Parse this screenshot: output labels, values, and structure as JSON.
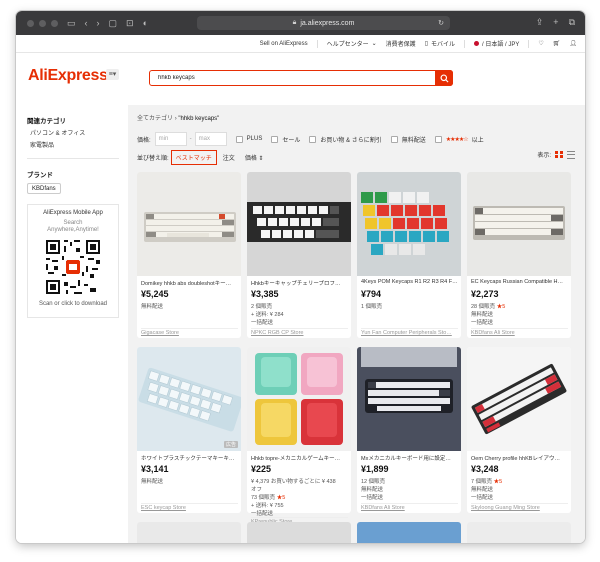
{
  "browser": {
    "url": "ja.aliexpress.com"
  },
  "topstrip": {
    "sell": "Sell on AliExpress",
    "help": "ヘルプセンター",
    "consumer": "消費者保護",
    "mobile": "モバイル",
    "locale": "/ 日本語 / JPY"
  },
  "header": {
    "logo": "AliExpress",
    "search_value": "hhkb keycaps"
  },
  "sidebar": {
    "related_heading": "関連カテゴリ",
    "related": [
      "パソコン & オフィス",
      "家電製品"
    ],
    "brand_heading": "ブランド",
    "brand_chip": "KBDfans",
    "app_title": "AliExpress Mobile App",
    "app_line2": "Search",
    "app_line3": "Anywhere,Anytime!",
    "app_scan": "Scan or click to download"
  },
  "main": {
    "breadcrumb_all": "全てカテゴリ",
    "breadcrumb_sep": "›",
    "breadcrumb_query": "\"hhkb keycaps\"",
    "price_label": "価格:",
    "price_min": "min",
    "price_max": "max",
    "filters": [
      "PLUS",
      "セール",
      "お買い物 & さらに割引",
      "無料配送"
    ],
    "rating_stars": "★★★★☆",
    "rating_suffix": "以上",
    "sort_label": "並び替え順:",
    "sort_best": "ベストマッチ",
    "sort_orders": "注文",
    "sort_price": "価格 ⇕",
    "view_label": "表示:"
  },
  "products": [
    {
      "title": "Domikey hhkb abs doubleshotキー…",
      "price": "¥5,245",
      "l1": "無料配送",
      "l2": "",
      "l3": "",
      "l4": "",
      "store": "Gigacase Store"
    },
    {
      "title": "Hhkbキーキャップチェリープロフ…",
      "price": "¥3,385",
      "l1": "2 個販売",
      "l2": "+ 送料: ¥ 284",
      "l3": "一括配送",
      "l4": "",
      "store": "NPKC RGB CP Store"
    },
    {
      "title": "4Keys POM Keycaps R1 R2 R3 R4 F…",
      "price": "¥794",
      "l1": "1 個販売",
      "l2": "",
      "l3": "",
      "l4": "",
      "store": "Yun Fan Computer Peripherals Sto…"
    },
    {
      "title": "EC Keycaps Russian Compatible H…",
      "price": "¥2,273",
      "l1": "28 個販売",
      "l1_star": "★5",
      "l2": "無料配送",
      "l3": "一括配送",
      "l4": "",
      "store": "KBDfans Ali Store"
    },
    {
      "title": "ホワイトプラスチックテーマキーキ…",
      "price": "¥3,141",
      "l1": "無料配送",
      "l2": "",
      "l3": "",
      "l4": "",
      "store": "ESC keycap Store",
      "badge": "広告"
    },
    {
      "title": "Hhkb topre-メカニカルゲームキー…",
      "price": "¥225",
      "l1": "¥ 4,379 お買い物するごとに ¥ 438",
      "l2": "オフ",
      "l3": "73 個販売",
      "l3_star": "★5",
      "l4": "+ 送料: ¥ 755",
      "l5": "一括配送",
      "store": "KPrepublic Store"
    },
    {
      "title": "Mxメカニカルキーボード用に設定…",
      "price": "¥1,899",
      "l1": "12 個販売",
      "l2": "無料配送",
      "l3": "一括配送",
      "l4": "",
      "store": "KBDfans Ali Store"
    },
    {
      "title": "Oem Cherry profile hhKBレイアウ…",
      "price": "¥3,248",
      "l1": "7 個販売",
      "l1_star": "★5",
      "l2": "無料配送",
      "l3": "一括配送",
      "l4": "",
      "store": "Skyloong Guang Ming Store"
    }
  ],
  "colors": {
    "brand": "#e62e04",
    "chrome": "#3a3a3c"
  }
}
